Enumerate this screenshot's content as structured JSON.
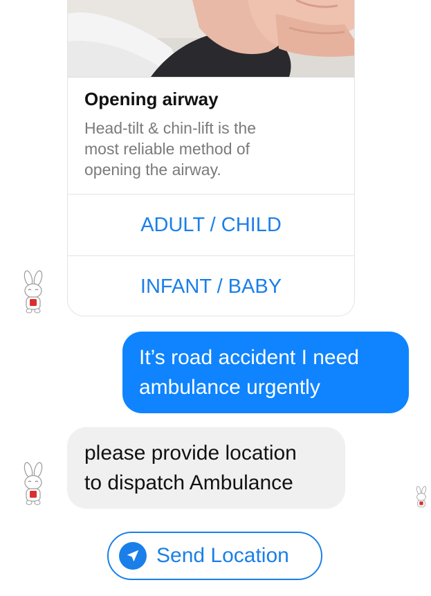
{
  "card": {
    "image_icon": "airway-photo",
    "title": "Opening airway",
    "subtitle_lines": [
      "Head-tilt & chin-lift is the",
      "most reliable method of",
      "opening the airway."
    ],
    "buttons": [
      {
        "label": "ADULT / CHILD"
      },
      {
        "label": "INFANT / BABY"
      }
    ]
  },
  "messages": {
    "outgoing": {
      "lines": [
        "It’s road accident I need",
        "ambulance urgently"
      ]
    },
    "incoming": {
      "lines": [
        "please provide location",
        "to dispatch Ambulance"
      ]
    }
  },
  "quick_reply": {
    "label": "Send Location",
    "icon": "location-arrow-icon"
  },
  "avatars": {
    "bot_icon": "bunny-bot-icon",
    "seen_icon": "bunny-seen-icon"
  },
  "colors": {
    "accent": "#1a7fe9",
    "outgoing_bubble": "#0f84fe",
    "incoming_bubble": "#f0f0f0",
    "subtitle_text": "#7a7a7a",
    "border": "#e3e3e3"
  }
}
